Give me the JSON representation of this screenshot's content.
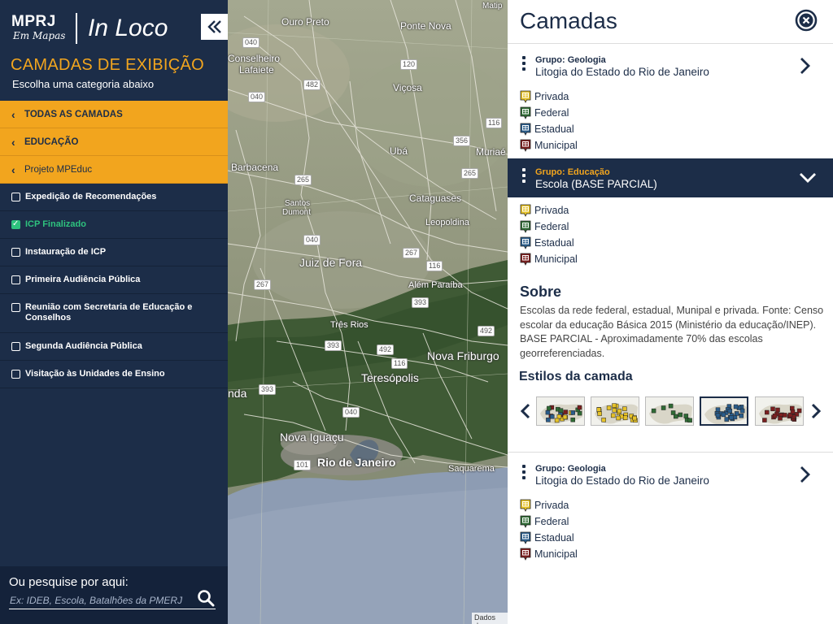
{
  "sidebar": {
    "brand": {
      "logo_text": "MPRJ",
      "logo_sub": "Em Mapas",
      "product": "In Loco"
    },
    "collapse_icon": "double-chevron-left-icon",
    "section_title": "CAMADAS DE EXIBIÇÃO",
    "section_subtitle": "Escolha uma categoria abaixo",
    "breadcrumbs": [
      {
        "label": "TODAS AS CAMADAS"
      },
      {
        "label": "EDUCAÇÃO"
      },
      {
        "label": "Projeto MPEduc"
      }
    ],
    "items": [
      {
        "label": "Expedição de Recomendações",
        "checked": false
      },
      {
        "label": "ICP Finalizado",
        "checked": true
      },
      {
        "label": "Instauração de ICP",
        "checked": false
      },
      {
        "label": "Primeira Audiência Pública",
        "checked": false
      },
      {
        "label": "Reunião com Secretaria de Educação e Conselhos",
        "checked": false
      },
      {
        "label": "Segunda Audiência Pública",
        "checked": false
      },
      {
        "label": "Visitação às Unidades de Ensino",
        "checked": false
      }
    ],
    "search": {
      "label": "Ou pesquise por aqui:",
      "placeholder": "Ex: IDEB, Escola, Batalhões da PMERJ",
      "icon": "search-icon"
    }
  },
  "map": {
    "labels": {
      "ouro_preto": "Ouro Preto",
      "ponte_nova": "Ponte Nova",
      "conselheiro": "Conselheiro",
      "lafaiete": "Lafaiete",
      "vicosa": "Viçosa",
      "uba": "Ubá",
      "muriae": "Muriaé",
      "barbacena": "Barbacena",
      "santos": "Santos",
      "dumont": "Dumont",
      "cataguases": "Cataguases",
      "leopoldina": "Leopoldina",
      "juiz_de_fora": "Juiz de Fora",
      "alem_paraiba": "Além Paraíba",
      "tres_rios": "Três Rios",
      "nova_friburgo": "Nova Friburgo",
      "teresopolis": "Teresópolis",
      "nda": "nda",
      "nova_iguacu": "Nova Iguaçu",
      "rio_de_janeiro": "Rio de Janeiro",
      "saquarema": "Saquarema",
      "matip": "Matip"
    },
    "shields": [
      "040",
      "482",
      "120",
      "040",
      "116",
      "356",
      "265",
      "265",
      "040",
      "267",
      "116",
      "267",
      "393",
      "492",
      "393",
      "492",
      "116",
      "393",
      "040",
      "101"
    ],
    "attribution": "Dados do"
  },
  "panel": {
    "title": "Camadas",
    "close_icon": "close-circle-icon",
    "layers": [
      {
        "group": "Grupo: Geologia",
        "name": "Litogia do Estado do Rio de Janeiro",
        "expanded": false,
        "legend": [
          "Privada",
          "Federal",
          "Estadual",
          "Municipal"
        ]
      },
      {
        "group": "Grupo: Educação",
        "name": "Escola (BASE PARCIAL)",
        "expanded": true,
        "legend": [
          "Privada",
          "Federal",
          "Estadual",
          "Municipal"
        ]
      },
      {
        "group": "Grupo: Geologia",
        "name": "Litogia do Estado do Rio de Janeiro",
        "expanded": false,
        "legend": [
          "Privada",
          "Federal",
          "Estadual",
          "Municipal"
        ]
      }
    ],
    "sobre_title": "Sobre",
    "sobre_text": "Escolas da rede federal, estadual, Munipal e privada. Fonte: Censo escolar da educação Básica 2015 (Ministério da educação/INEP). BASE PARCIAL - Aproximadamente 70% das escolas georreferenciadas.",
    "estilos_title": "Estilos da camada",
    "legend_colors": {
      "Privada": "#e6c229",
      "Federal": "#2f6b35",
      "Estadual": "#2a5c8a",
      "Municipal": "#7b1f1f"
    },
    "style_thumbs": [
      "multi-color",
      "yellow",
      "green",
      "blue",
      "red"
    ],
    "selected_style": "blue"
  },
  "colors": {
    "navy": "#1c2d48",
    "accent": "#f2a51e",
    "success": "#2ec27e"
  }
}
